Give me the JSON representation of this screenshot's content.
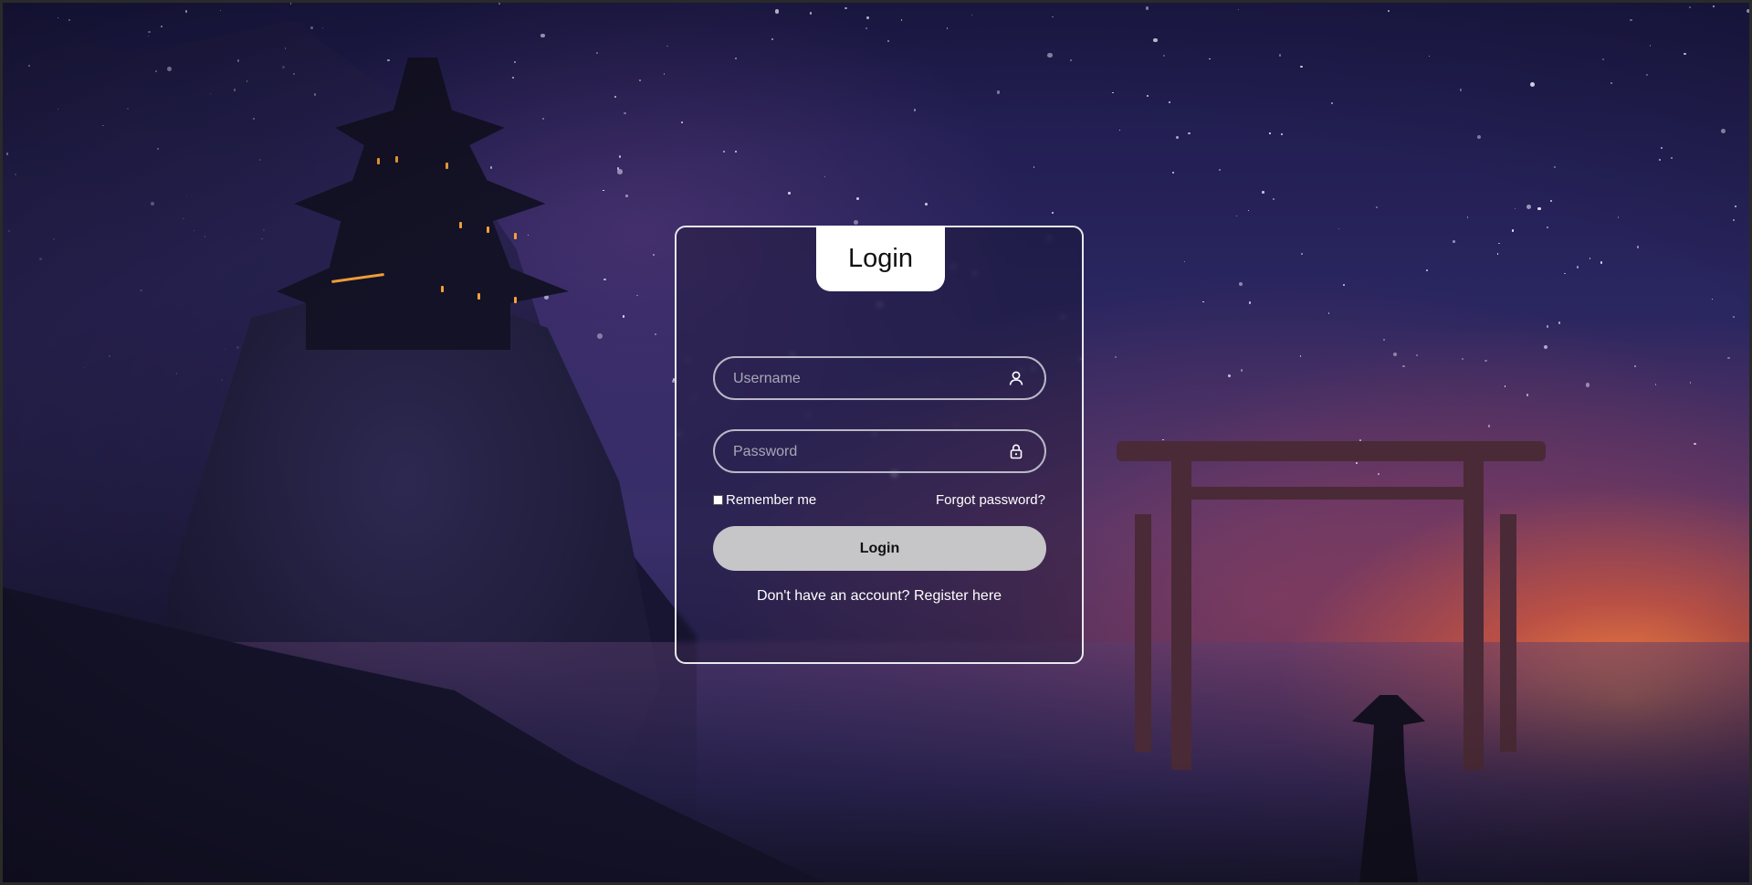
{
  "login": {
    "title": "Login",
    "username": {
      "placeholder": "Username",
      "icon": "user-icon"
    },
    "password": {
      "placeholder": "Password",
      "icon": "lock-icon"
    },
    "remember_label": "Remember me",
    "remember_checked": false,
    "forgot_label": "Forgot password?",
    "submit_label": "Login",
    "register_label": "Don't have an account? Register here"
  },
  "colors": {
    "card_border": "#e8e8ee",
    "button_bg": "#c6c5c8",
    "title_bg": "#ffffff"
  }
}
